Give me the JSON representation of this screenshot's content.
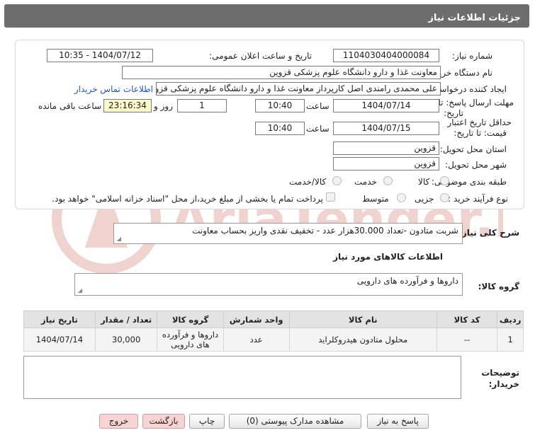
{
  "header": {
    "title": "جزئیات اطلاعات نیاز"
  },
  "fields": {
    "need_number_label": "شماره نیاز:",
    "need_number": "1104030404000084",
    "announce_label": "تاریخ و ساعت اعلان عمومی:",
    "announce_value": "1404/07/12 - 10:35",
    "buyer_org_label": "نام دستگاه خریدار:",
    "buyer_org": "معاونت غذا و دارو دانشگاه علوم پزشکی قزوین",
    "requester_label": "ایجاد کننده درخواست:",
    "requester": "علی محمدی رامندی اصل کارپرداز معاونت غذا و دارو دانشگاه علوم پزشکی قزوین",
    "contact_link": "اطلاعات تماس خریدار",
    "deadline_label_1": "مهلت ارسال پاسخ: تا",
    "deadline_label_2": "تاریخ:",
    "deadline_date": "1404/07/14",
    "hour_label": "ساعت",
    "deadline_time": "10:40",
    "days_value": "1",
    "days_label": "روز و",
    "remaining_time": "23:16:34",
    "remaining_label": "ساعت باقی مانده",
    "validity_label_1": "حداقل تاریخ اعتبار",
    "validity_label_2": "قیمت: تا تاریخ:",
    "validity_date": "1404/07/15",
    "validity_time": "10:40",
    "province_label": "استان محل تحویل:",
    "province": "قزوین",
    "city_label": "شهر محل تحویل:",
    "city": "قزوین",
    "category_label": "طبقه بندی موضوعی:",
    "category_options": [
      "کالا",
      "خدمت",
      "کالا/خدمت"
    ],
    "process_label": "نوع فرآیند خرید :",
    "process_options": [
      "جزیی",
      "متوسط"
    ],
    "payment_note": "پرداخت تمام یا بخشی از مبلغ خرید،از محل \"اسناد خزانه اسلامی\" خواهد بود."
  },
  "description": {
    "label": "شرح کلی نیاز:",
    "text": "شربت متادون -تعداد 30.000هزار عدد - تخفیف نقدی واریز بحساب معاونت"
  },
  "goods_info": {
    "title": "اطلاعات کالاهای مورد نیاز",
    "group_label": "گروه کالا:",
    "group_value": "داروها و فرآورده های دارویی"
  },
  "table": {
    "headers": [
      "ردیف",
      "کد کالا",
      "نام کالا",
      "واحد شمارش",
      "گروه کالا",
      "تعداد / مقدار",
      "تاریخ نیاز"
    ],
    "rows": [
      [
        "1",
        "--",
        "محلول متادون هیدروکلراید",
        "عدد",
        "داروها و فرآورده های دارویی",
        "30,000",
        "1404/07/14"
      ]
    ]
  },
  "buyer_notes": {
    "label_1": "توضیحات",
    "label_2": "خریدار:",
    "text": ""
  },
  "buttons": {
    "reply": "پاسخ به نیاز",
    "attachments": "مشاهده مدارک پیوستی (0)",
    "print": "چاپ",
    "back": "بازگشت",
    "exit": "خروج"
  },
  "watermark_text": "AriaTender.neT",
  "colors": {
    "header_bg": "#6d6d6d",
    "link": "#1f57b8",
    "yellow_box": "#fdf8c9",
    "red_button": "#f7d3d3"
  }
}
